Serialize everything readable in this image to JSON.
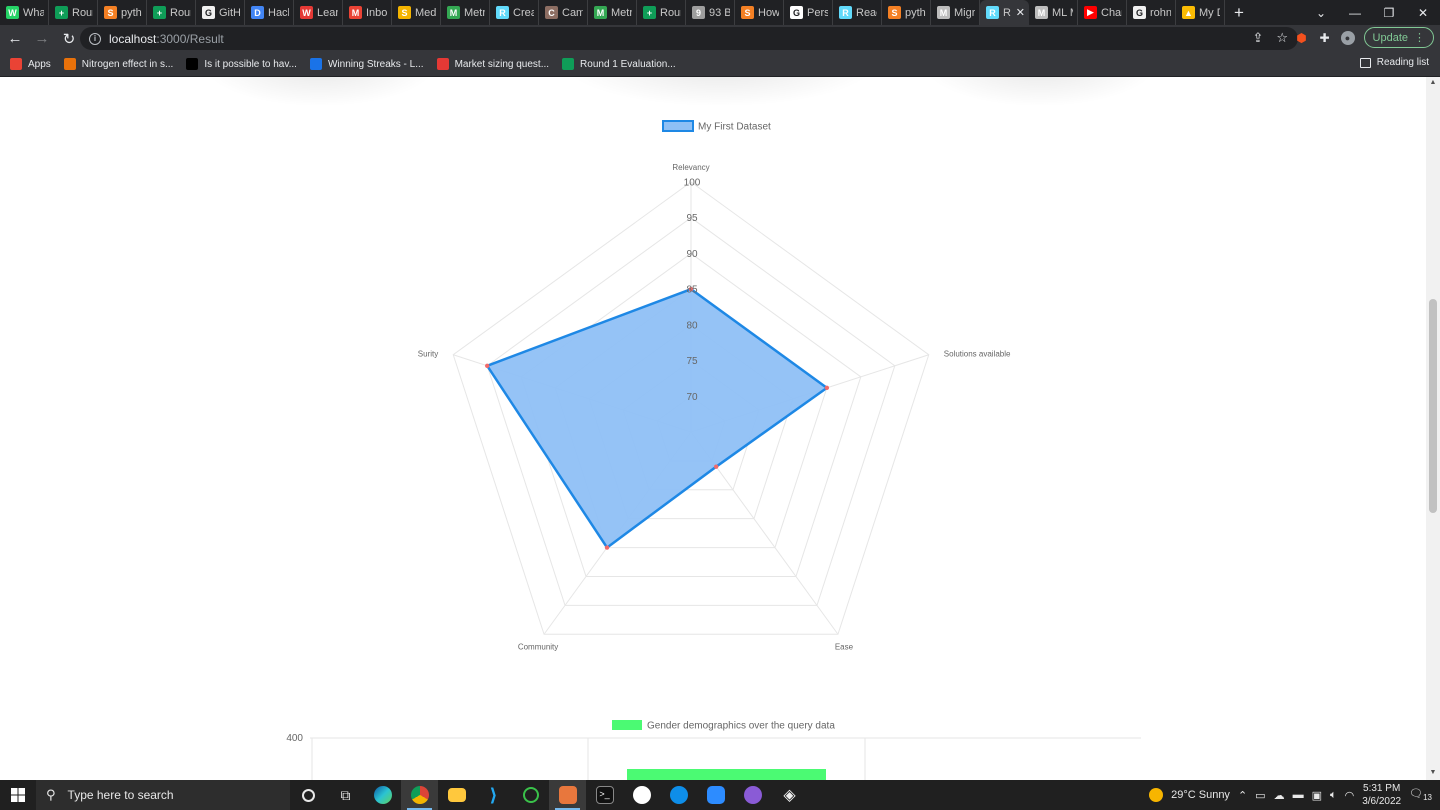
{
  "browser": {
    "tabs": [
      {
        "title": "WhatsApp",
        "icon": "whatsapp-icon",
        "color": "#25d366",
        "glyph": "W"
      },
      {
        "title": "Round",
        "icon": "sheets-icon",
        "color": "#0f9d58",
        "glyph": "+"
      },
      {
        "title": "python",
        "icon": "stackoverflow-icon",
        "color": "#f48024",
        "glyph": "S"
      },
      {
        "title": "Round",
        "icon": "sheets-icon",
        "color": "#0f9d58",
        "glyph": "+"
      },
      {
        "title": "GitHub",
        "icon": "github-icon",
        "color": "#f0f0f0",
        "glyph": "G"
      },
      {
        "title": "Hack",
        "icon": "docs-icon",
        "color": "#4285f4",
        "glyph": "D"
      },
      {
        "title": "Learn",
        "icon": "learn-icon",
        "color": "#e53935",
        "glyph": "W"
      },
      {
        "title": "Inbox",
        "icon": "gmail-icon",
        "color": "#ea4335",
        "glyph": "M"
      },
      {
        "title": "Med",
        "icon": "slides-icon",
        "color": "#f4b400",
        "glyph": "S"
      },
      {
        "title": "Metr",
        "icon": "metrics-icon",
        "color": "#34a853",
        "glyph": "M"
      },
      {
        "title": "Crea",
        "icon": "react-icon",
        "color": "#61dafb",
        "glyph": "R"
      },
      {
        "title": "Cam",
        "icon": "camera-icon",
        "color": "#8d6e63",
        "glyph": "C"
      },
      {
        "title": "Metr",
        "icon": "metrics-icon",
        "color": "#34a853",
        "glyph": "M"
      },
      {
        "title": "Round",
        "icon": "sheets-icon",
        "color": "#0f9d58",
        "glyph": "+"
      },
      {
        "title": "93 B",
        "icon": "page-icon",
        "color": "#9e9e9e",
        "glyph": "9"
      },
      {
        "title": "How",
        "icon": "stackoverflow-icon",
        "color": "#f48024",
        "glyph": "S"
      },
      {
        "title": "Perso",
        "icon": "google-icon",
        "color": "#ffffff",
        "glyph": "G"
      },
      {
        "title": "React",
        "icon": "react-icon",
        "color": "#61dafb",
        "glyph": "R"
      },
      {
        "title": "python",
        "icon": "stackoverflow-icon",
        "color": "#f48024",
        "glyph": "S"
      },
      {
        "title": "Migr",
        "icon": "migrate-icon",
        "color": "#bdbdbd",
        "glyph": "M"
      },
      {
        "title": "R",
        "icon": "react-icon",
        "color": "#61dafb",
        "glyph": "R",
        "active": true
      },
      {
        "title": "ML M",
        "icon": "globe-icon",
        "color": "#bdbdbd",
        "glyph": "M"
      },
      {
        "title": "Char",
        "icon": "youtube-icon",
        "color": "#ff0000",
        "glyph": "▶"
      },
      {
        "title": "rohn",
        "icon": "github-icon",
        "color": "#f0f0f0",
        "glyph": "G"
      },
      {
        "title": "My D",
        "icon": "drive-icon",
        "color": "#fbbc04",
        "glyph": "▲"
      }
    ],
    "url_host": "localhost",
    "url_path": ":3000/Result",
    "update_label": "Update",
    "bookmarks": [
      {
        "label": "Apps",
        "icon": "apps-grid-icon",
        "color": "#ea4335"
      },
      {
        "label": "Nitrogen effect in s...",
        "icon": "bookmark-site-icon",
        "color": "#e8710a"
      },
      {
        "label": "Is it possible to hav...",
        "icon": "bookmark-site-icon",
        "color": "#000000"
      },
      {
        "label": "Winning Streaks - L...",
        "icon": "bookmark-site-icon",
        "color": "#1a73e8"
      },
      {
        "label": "Market sizing quest...",
        "icon": "bookmark-site-icon",
        "color": "#e53935"
      },
      {
        "label": "Round 1 Evaluation...",
        "icon": "sheets-icon",
        "color": "#0f9d58"
      }
    ],
    "reading_list": "Reading list"
  },
  "chart_data": [
    {
      "type": "radar",
      "legend": "My First Dataset",
      "legend_color": "#1e88e5",
      "fill_color": "#8fc0f5",
      "labels": [
        "Relevancy",
        "Solutions available",
        "Ease",
        "Community",
        "Surity"
      ],
      "values": [
        85,
        85,
        71,
        85,
        95
      ],
      "scale": {
        "min": 65,
        "max": 100,
        "ticks": [
          70,
          75,
          80,
          85,
          90,
          95,
          100
        ]
      },
      "grid": true
    },
    {
      "type": "bar",
      "legend": "Gender demographics over the query data",
      "bar_color": "#4bfa73",
      "y_ticks_visible": [
        "400"
      ],
      "partially_visible": true
    }
  ],
  "taskbar": {
    "search_placeholder": "Type here to search",
    "weather": "29°C  Sunny",
    "time": "5:31 PM",
    "date": "3/6/2022",
    "notifications": "13"
  }
}
